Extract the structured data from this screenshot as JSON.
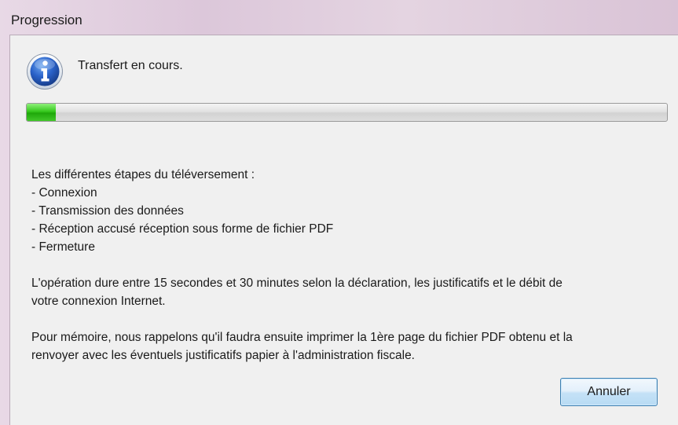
{
  "window": {
    "title": "Progression"
  },
  "status": {
    "icon": "info-icon",
    "text": "Transfert en cours."
  },
  "progress": {
    "percent": 4.5,
    "color": "#2fc018"
  },
  "body": {
    "steps_heading": "Les différentes étapes du téléversement :",
    "steps": [
      "- Connexion",
      "- Transmission des données",
      "- Réception accusé réception sous forme de fichier PDF",
      "- Fermeture"
    ],
    "duration_line1": "L'opération dure entre 15 secondes et 30 minutes selon la déclaration, les justificatifs et le débit de",
    "duration_line2": "votre connexion Internet.",
    "reminder_line1": "Pour mémoire, nous rappelons qu'il faudra ensuite imprimer la 1ère page du fichier PDF obtenu et la",
    "reminder_line2": "renvoyer avec les éventuels justificatifs papier à l'administration fiscale."
  },
  "buttons": {
    "cancel_label": "Annuler"
  }
}
